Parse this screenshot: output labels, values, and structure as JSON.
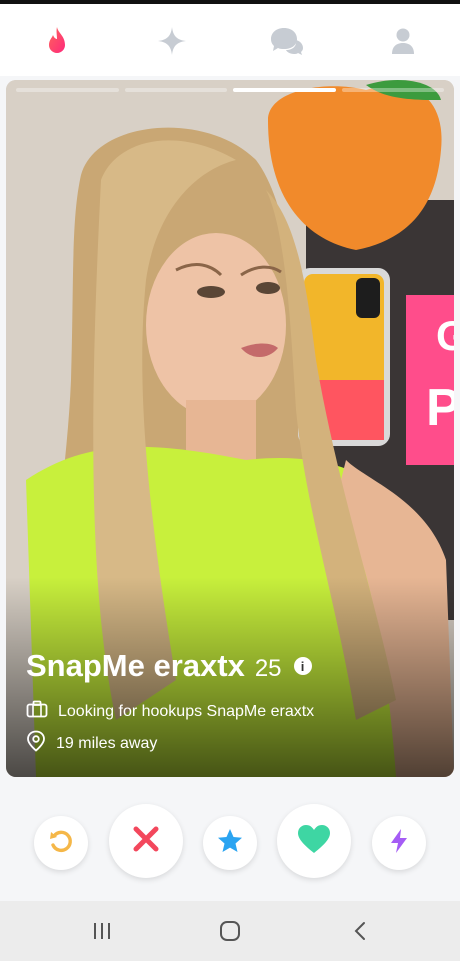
{
  "top_nav": {
    "items": [
      {
        "icon": "flame-icon",
        "active": true
      },
      {
        "icon": "sparkle-icon",
        "active": false
      },
      {
        "icon": "chat-bubbles-icon",
        "active": false
      },
      {
        "icon": "profile-icon",
        "active": false
      }
    ],
    "accent": "#fd5068"
  },
  "profile": {
    "name": "SnapMe eraxtx",
    "age": "25",
    "info_glyph": "i",
    "job": "Looking for hookups SnapMe eraxtx",
    "distance": "19 miles away",
    "photo_count": 4,
    "active_photo": 3
  },
  "actions": {
    "rewind": {
      "icon": "rewind-icon",
      "color": "#f5b748"
    },
    "nope": {
      "icon": "x-icon",
      "color": "#f3475c"
    },
    "super_like": {
      "icon": "star-icon",
      "color": "#2ba4f1"
    },
    "like": {
      "icon": "heart-icon",
      "color": "#3ed6a3"
    },
    "boost": {
      "icon": "bolt-icon",
      "color": "#a55cf5"
    }
  },
  "system_nav": {
    "items": [
      "recents-icon",
      "home-icon",
      "back-icon"
    ]
  }
}
